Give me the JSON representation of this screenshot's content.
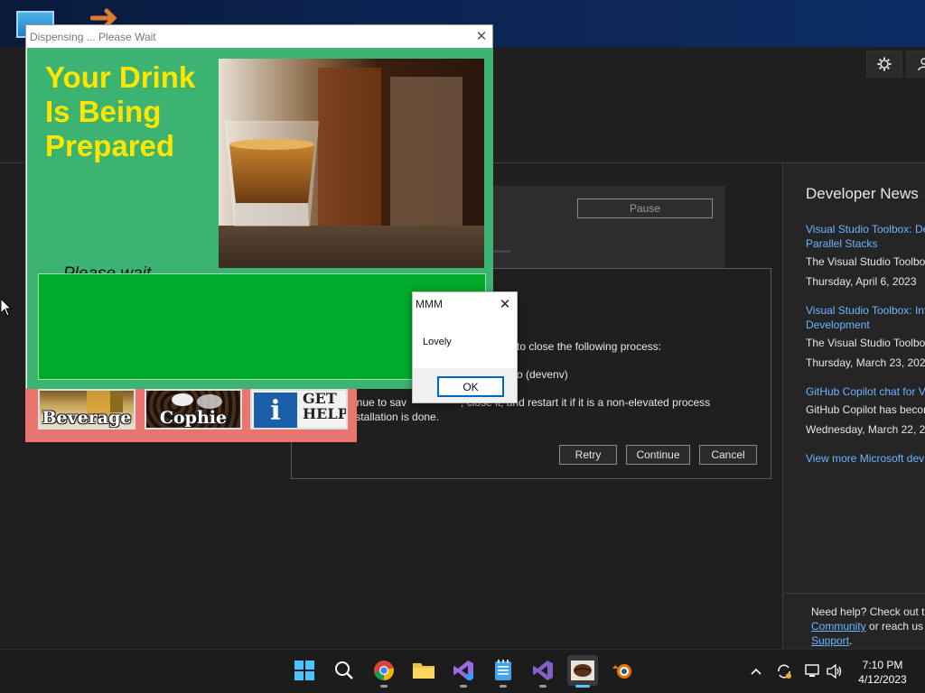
{
  "dispensing_window": {
    "title": "Dispensing ... Please Wait",
    "close_glyph": "✕",
    "heading": "Your Drink Is Being Prepared",
    "status": "Please wait.........",
    "image": "glass-of-whisky-photo"
  },
  "product_tiles": [
    {
      "label": "Beverage",
      "icon": "beverage-photo"
    },
    {
      "label": "Cophie",
      "icon": "coffee-beans-photo"
    },
    {
      "label": "GET HELP",
      "icon": "info-icon"
    }
  ],
  "message_box": {
    "title": "MMM",
    "close_glyph": "✕",
    "message": "Lovely",
    "ok_label": "OK"
  },
  "installer": {
    "pause_label": "Pause",
    "dialog_lines": [
      "to close the following process:",
      "o (devenv)",
      "ntinue to sav                  , close it, and restart it if it is a non-elevated process",
      "installation is done."
    ],
    "retry_label": "Retry",
    "continue_label": "Continue",
    "cancel_label": "Cancel"
  },
  "developer_news": {
    "title": "Developer News",
    "items": [
      {
        "link_line1": "Visual Studio Toolbox: De",
        "link_line2": "Parallel Stacks",
        "summary": "The Visual Studio Toolbox",
        "date": "Thursday, April 6, 2023"
      },
      {
        "link_line1": "Visual Studio Toolbox: Int",
        "link_line2": "Development",
        "summary": "The Visual Studio Toolbox",
        "date": "Thursday, March 23, 2023"
      },
      {
        "link_line1": "GitHub Copilot chat for V",
        "link_line2": "",
        "summary": "GitHub Copilot has becor",
        "date": "Wednesday, March 22, 20"
      }
    ],
    "more_link": "View more Microsoft dev"
  },
  "help_footer": {
    "line1": "Need help? Check out th",
    "community_link": "Community",
    "line2_rest": " or reach us",
    "support_link": "Support",
    "line3_rest": "."
  },
  "taskbar": {
    "apps": [
      {
        "name": "start-button",
        "icon": "windows-logo-icon"
      },
      {
        "name": "search-button",
        "icon": "search-icon"
      },
      {
        "name": "chrome",
        "icon": "chrome-icon"
      },
      {
        "name": "file-explorer",
        "icon": "folder-icon"
      },
      {
        "name": "visual-studio-installer",
        "icon": "vs-installer-icon"
      },
      {
        "name": "notepad",
        "icon": "notepad-icon"
      },
      {
        "name": "visual-studio",
        "icon": "visual-studio-icon"
      },
      {
        "name": "coffee-app",
        "icon": "coffee-bean-icon"
      },
      {
        "name": "blender",
        "icon": "blender-icon"
      }
    ],
    "clock_time": "7:10 PM",
    "clock_date": "4/12/2023"
  },
  "colors": {
    "window_body": "#3cb371",
    "heading": "#ffe600",
    "progress_area": "#00aa2a",
    "tile_bar": "#e9756f",
    "news_link": "#6cb6ff",
    "taskbar": "#1c1c1c"
  }
}
